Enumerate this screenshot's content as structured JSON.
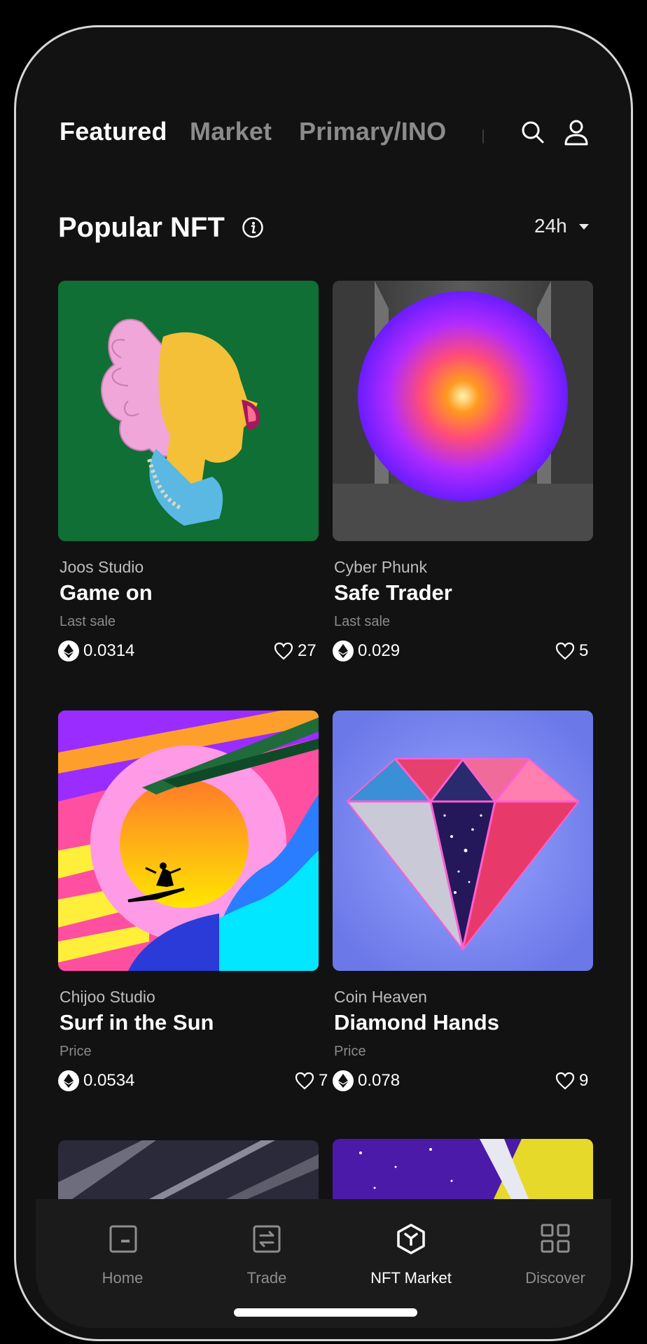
{
  "header": {
    "tabs": [
      {
        "label": "Featured",
        "active": true
      },
      {
        "label": "Market",
        "active": false
      },
      {
        "label": "Primary/INO",
        "active": false
      }
    ],
    "search_icon": "search-icon",
    "profile_icon": "user-icon"
  },
  "section": {
    "title": "Popular NFT",
    "info_icon": "info-icon",
    "period": "24h"
  },
  "cards": [
    {
      "creator": "Joos Studio",
      "title": "Game on",
      "label": "Last sale",
      "price": "0.0314",
      "likes": "27"
    },
    {
      "creator": "Cyber Phunk",
      "title": "Safe Trader",
      "label": "Last sale",
      "price": "0.029",
      "likes": "5"
    },
    {
      "creator": "Chijoo Studio",
      "title": "Surf in the Sun",
      "label": "Price",
      "price": "0.0534",
      "likes": "7"
    },
    {
      "creator": "Coin Heaven",
      "title": "Diamond Hands",
      "label": "Price",
      "price": "0.078",
      "likes": "9"
    }
  ],
  "bottom_nav": [
    {
      "label": "Home",
      "icon": "wallet-icon",
      "active": false
    },
    {
      "label": "Trade",
      "icon": "swap-icon",
      "active": false
    },
    {
      "label": "NFT Market",
      "icon": "nft-hexagon-icon",
      "active": true
    },
    {
      "label": "Discover",
      "icon": "grid-icon",
      "active": false
    }
  ],
  "colors": {
    "background": "#121212",
    "text_primary": "#ffffff",
    "text_muted": "#8b8b8b",
    "bottom_bar": "#1b1b1b"
  }
}
